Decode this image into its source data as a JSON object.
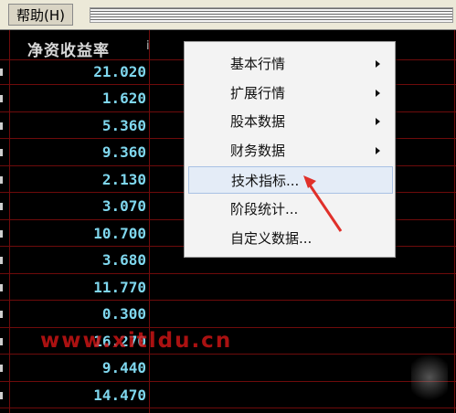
{
  "menubar": {
    "help_label": "帮助(H)"
  },
  "table": {
    "column_title": "净资收益率",
    "column_title_extra": "i",
    "values": [
      "21.020",
      "1.620",
      "5.360",
      "9.360",
      "2.130",
      "3.070",
      "10.700",
      "3.680",
      "11.770",
      "0.300",
      "16.270",
      "9.440",
      "14.470"
    ]
  },
  "context_menu": {
    "items": [
      {
        "label": "基本行情",
        "submenu": true
      },
      {
        "label": "扩展行情",
        "submenu": true
      },
      {
        "label": "股本数据",
        "submenu": true
      },
      {
        "label": "财务数据",
        "submenu": true
      },
      {
        "label": "技术指标...",
        "submenu": false,
        "highlighted": true
      },
      {
        "label": "阶段统计...",
        "submenu": false
      },
      {
        "label": "自定义数据...",
        "submenu": false
      }
    ]
  },
  "watermark": "www.xitldu.cn",
  "colors": {
    "value_text": "#7fd7ee",
    "grid_line": "#6e0b0b",
    "pointer": "#e0302a"
  }
}
